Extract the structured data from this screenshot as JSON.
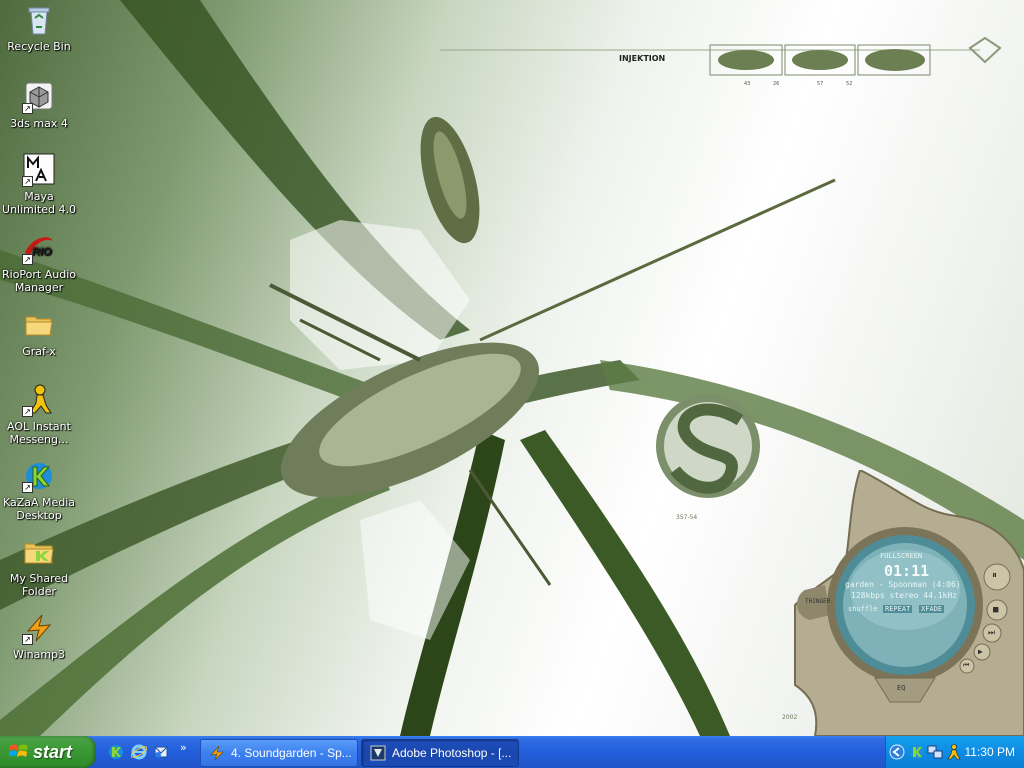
{
  "desktop": {
    "icons": [
      {
        "label": "Recycle Bin",
        "icon": "recycle-bin-icon"
      },
      {
        "label": "3ds max 4",
        "icon": "3ds-max-icon"
      },
      {
        "label": "Maya Unlimited 4.0",
        "icon": "maya-icon"
      },
      {
        "label": "RioPort Audio Manager",
        "icon": "rioport-icon"
      },
      {
        "label": "Graf-x",
        "icon": "folder-icon"
      },
      {
        "label": "AOL Instant Messeng...",
        "icon": "aim-icon"
      },
      {
        "label": "KaZaA Media Desktop",
        "icon": "kazaa-icon"
      },
      {
        "label": "My Shared Folder",
        "icon": "shared-folder-icon"
      },
      {
        "label": "Winamp3",
        "icon": "winamp-icon"
      }
    ],
    "wallpaper": {
      "brand": "INJEKTION",
      "caption_left": "357-54",
      "caption_year": "2002",
      "thumb_labels": [
        "43",
        "26",
        "57",
        "52"
      ]
    }
  },
  "winamp": {
    "fullscreen_label": "FULLSCREEN",
    "time": "01:11",
    "track": "garden - Spoonman (4:06)",
    "stream_info": "128kbps stereo 44.1kHz",
    "shuffle_label": "shuffle",
    "repeat_label": "REPEAT",
    "crossfade_label": "XFADE",
    "thinger_label": "THINGER",
    "eq_label": "EQ",
    "accent_color": "#7fb2b8"
  },
  "taskbar": {
    "start_label": "start",
    "quicklaunch": [
      "kazaa-icon",
      "ie-icon",
      "outlook-icon"
    ],
    "chevron": "»",
    "tasks": [
      {
        "label": "4. Soundgarden - Sp...",
        "icon": "winamp-icon",
        "active": false
      },
      {
        "label": "Adobe Photoshop - [...",
        "icon": "photoshop-icon",
        "active": true
      }
    ],
    "tray_icons": [
      "collapse-arrow-icon",
      "kazaa-icon",
      "network-icon",
      "aim-icon"
    ],
    "clock": "11:30 PM",
    "colors": {
      "bar": "#245edb",
      "start": "#3c9a36",
      "tray": "#0e8be3"
    }
  }
}
